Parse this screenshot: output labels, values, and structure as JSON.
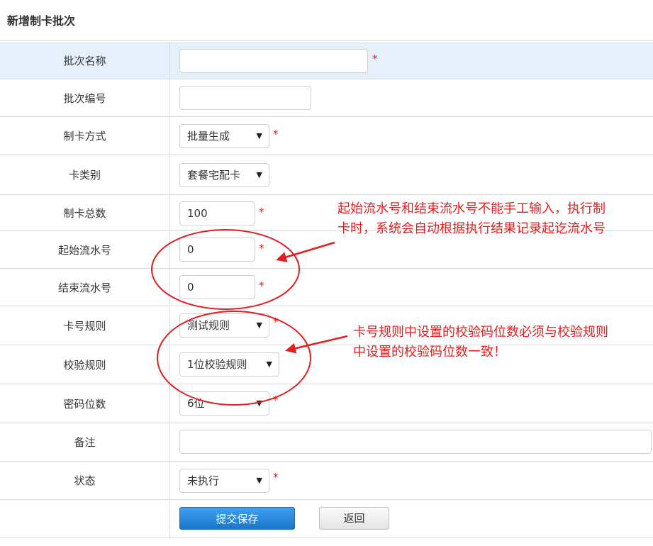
{
  "page": {
    "title": "新增制卡批次"
  },
  "form": {
    "batch_name": {
      "label": "批次名称",
      "value": "",
      "required": "*"
    },
    "batch_no": {
      "label": "批次编号",
      "value": ""
    },
    "card_method": {
      "label": "制卡方式",
      "value": "批量生成",
      "required": "*"
    },
    "card_type": {
      "label": "卡类别",
      "value": "套餐宅配卡"
    },
    "total": {
      "label": "制卡总数",
      "value": "100",
      "required": "*"
    },
    "start_serial": {
      "label": "起始流水号",
      "value": "0",
      "required": "*"
    },
    "end_serial": {
      "label": "结束流水号",
      "value": "0",
      "required": "*"
    },
    "card_rule": {
      "label": "卡号规则",
      "value": "测试规则",
      "required": "*"
    },
    "check_rule": {
      "label": "校验规则",
      "value": "1位校验规则"
    },
    "pwd_digits": {
      "label": "密码位数",
      "value": "6位",
      "required": "*"
    },
    "remark": {
      "label": "备注",
      "value": ""
    },
    "status": {
      "label": "状态",
      "value": "未执行",
      "required": "*"
    }
  },
  "buttons": {
    "submit": "提交保存",
    "back": "返回"
  },
  "annotations": {
    "serial_note_line1": "起始流水号和结束流水号不能手工输入，执行制",
    "serial_note_line2": "卡时，系统会自动根据执行结果记录起讫流水号",
    "rule_note_line1": "卡号规则中设置的校验码位数必须与校验规则",
    "rule_note_line2": "中设置的校验码位数一致！"
  },
  "colors": {
    "annotation_red": "#e02020",
    "primary_blue": "#1b75c9",
    "highlight_row": "#e6f0fb"
  }
}
